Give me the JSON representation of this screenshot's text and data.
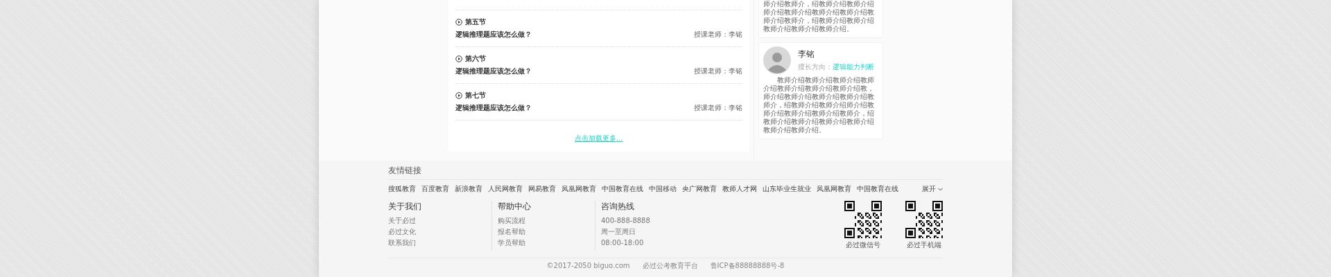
{
  "lessons": [
    {
      "section": "第五节",
      "title": "逻辑推理题应该怎么做？",
      "teacher": "授课老师：李铭"
    },
    {
      "section": "第六节",
      "title": "逻辑推理题应该怎么做？",
      "teacher": "授课老师：李铭"
    },
    {
      "section": "第七节",
      "title": "逻辑推理题应该怎么做？",
      "teacher": "授课老师：李铭"
    }
  ],
  "load_more": "点击加载更多...",
  "teacher_cards": [
    {
      "bio": "师介绍教师介，绍教师介绍教师介绍师介绍教师介绍教师介绍教师介绍教师介绍教师介，绍教师介绍教师介绍教师介绍教师介绍教师介绍。"
    },
    {
      "name": "李铭",
      "specialty_label": "擅长方向：",
      "specialty": "逻辑能力判断",
      "bio": "教师介绍教师介绍教师介绍教师介绍教师介绍教师介绍教师介绍教，师介绍教师介绍教师介绍教师介绍教师介，绍教师介绍教师介绍师介绍教师介绍教师介绍教师介绍教师介，绍教师介绍教师介绍教师介绍教师介绍教师介绍教师介绍。"
    }
  ],
  "footer": {
    "links_title": "友情链接",
    "links": [
      "搜狐教育",
      "百度教育",
      "新浪教育",
      "人民网教育",
      "网易教育",
      "凤凰网教育",
      "中国教育在线",
      "中国移动",
      "央广网教育",
      "教师人才网",
      "山东毕业生就业",
      "凤凰网教育",
      "中国教育在线"
    ],
    "expand": "展开",
    "columns": [
      {
        "title": "关于我们",
        "items": [
          "关于必过",
          "必过文化",
          "联系我们"
        ]
      },
      {
        "title": "帮助中心",
        "items": [
          "购买流程",
          "报名帮助",
          "学员帮助"
        ]
      },
      {
        "title": "咨询热线",
        "items": [
          "400-888-8888",
          "周一至周日",
          "08:00-18:00"
        ]
      }
    ],
    "qr_codes": [
      {
        "caption": "必过微信号"
      },
      {
        "caption": "必过手机端"
      }
    ],
    "copyright": [
      "©2017-2050 biguo.com",
      "必过公考教育平台",
      "鲁ICP备88888888号-8"
    ]
  }
}
